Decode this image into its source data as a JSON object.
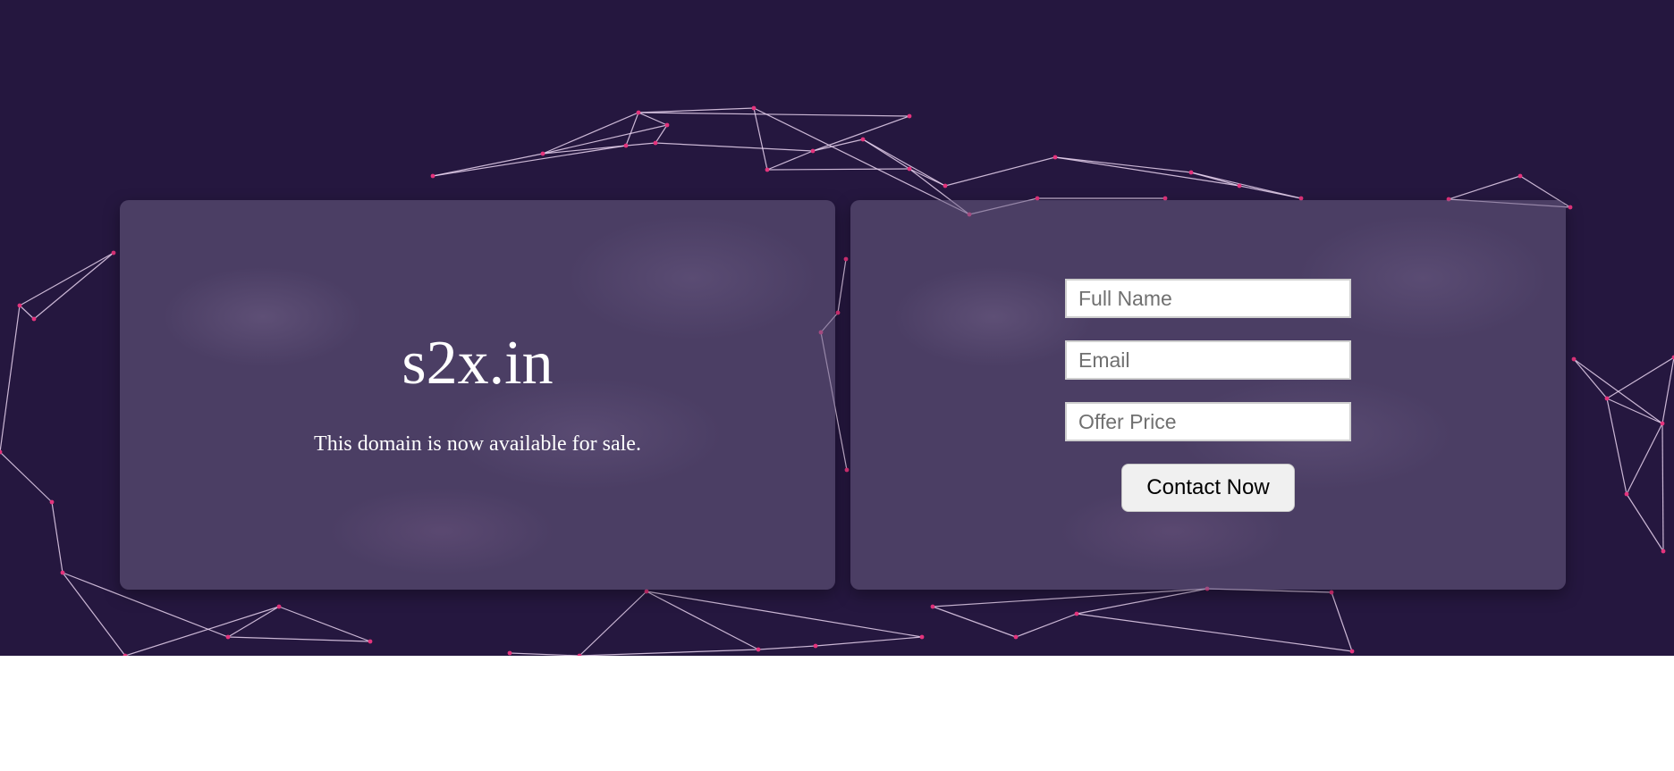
{
  "domain": {
    "name": "s2x.in",
    "tagline": "This domain is now available for sale."
  },
  "form": {
    "full_name_placeholder": "Full Name",
    "email_placeholder": "Email",
    "offer_price_placeholder": "Offer Price",
    "submit_label": "Contact Now"
  },
  "colors": {
    "background": "#25173f",
    "node": "#e4347d",
    "edge": "#e9d4f0",
    "page_below": "#ffffff"
  }
}
